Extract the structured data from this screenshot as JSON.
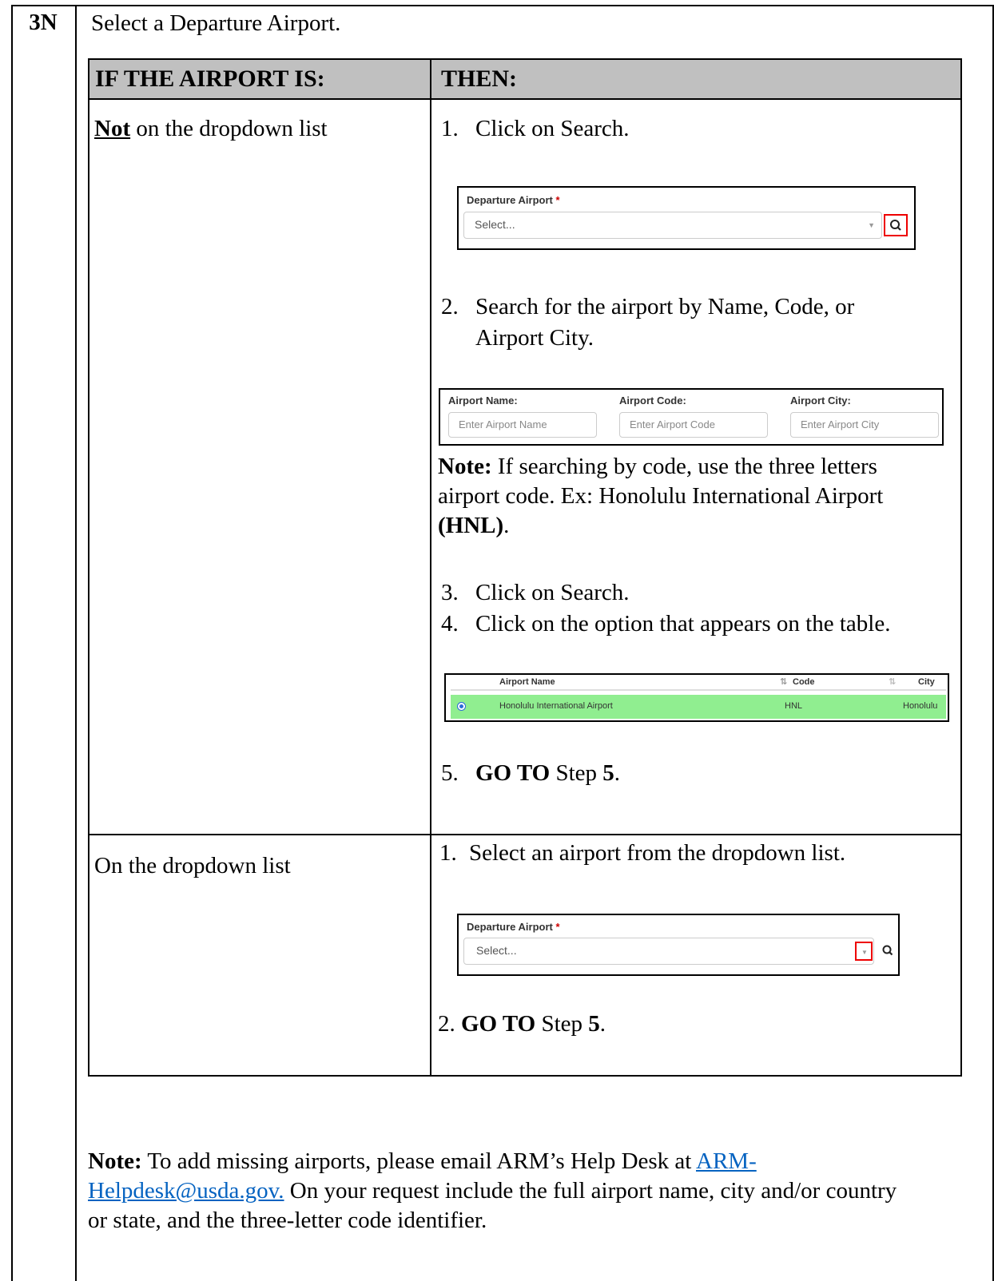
{
  "step": {
    "id": "3N",
    "instruction": "Select a Departure Airport."
  },
  "table": {
    "header": {
      "col1": "IF THE AIRPORT IS:",
      "col2": "THEN:"
    },
    "row1": {
      "cond_bold": "Not",
      "cond_rest": " on the dropdown list",
      "s1_num": "1.",
      "s1_text": "Click on Search.",
      "s2_num": "2.",
      "s2_text_a": "Search for the airport by Name, Code, or",
      "s2_text_b": "Airport City.",
      "note_bold": "Note:",
      "note_rest": " If searching by code, use the three letters",
      "note_line2": "airport code. Ex: Honolulu International Airport",
      "note_line3": "(HNL)",
      "note_line3_end": ".",
      "s3_num": "3.",
      "s3_text": "Click on Search.",
      "s4_num": "4.",
      "s4_text": "Click on the option that appears on the table.",
      "s5_num": "5.",
      "s5_goto": "GO TO",
      "s5_step": " Step ",
      "s5_n": "5",
      "s5_end": "."
    },
    "row2": {
      "cond": "On the dropdown list",
      "s1_num": "1.",
      "s1_text": "Select an airport from the dropdown list.",
      "s2_num": "2.",
      "s2_goto": "GO TO",
      "s2_step": " Step ",
      "s2_n": "5",
      "s2_end": "."
    }
  },
  "widget1": {
    "label": "Departure Airport",
    "required_mark": "*",
    "placeholder": "Select..."
  },
  "search_form": {
    "name_label": "Airport Name:",
    "name_placeholder": "Enter Airport Name",
    "code_label": "Airport Code:",
    "code_placeholder": "Enter Airport Code",
    "city_label": "Airport City:",
    "city_placeholder": "Enter Airport City"
  },
  "results": {
    "columns": [
      "Airport Name",
      "Code",
      "City"
    ],
    "row": {
      "name": "Honolulu International Airport",
      "code": "HNL",
      "city": "Honolulu",
      "selected": true
    },
    "highlight_color": "#90ee90"
  },
  "widget2": {
    "label": "Departure Airport",
    "required_mark": "*",
    "placeholder": "Select..."
  },
  "footer_note": {
    "bold": "Note:",
    "text_a": " To add missing airports, please email ARM’s Help Desk at ",
    "link_a": "ARM-",
    "link_b": "Helpdesk@usda.gov.",
    "text_b": " On your request include the full airport name, city and/or country",
    "text_c": "or state, and the three-letter code identifier."
  },
  "colors": {
    "header_bg": "#c0c0c0",
    "highlight_border": "#ee0000",
    "link": "#0563c1"
  }
}
